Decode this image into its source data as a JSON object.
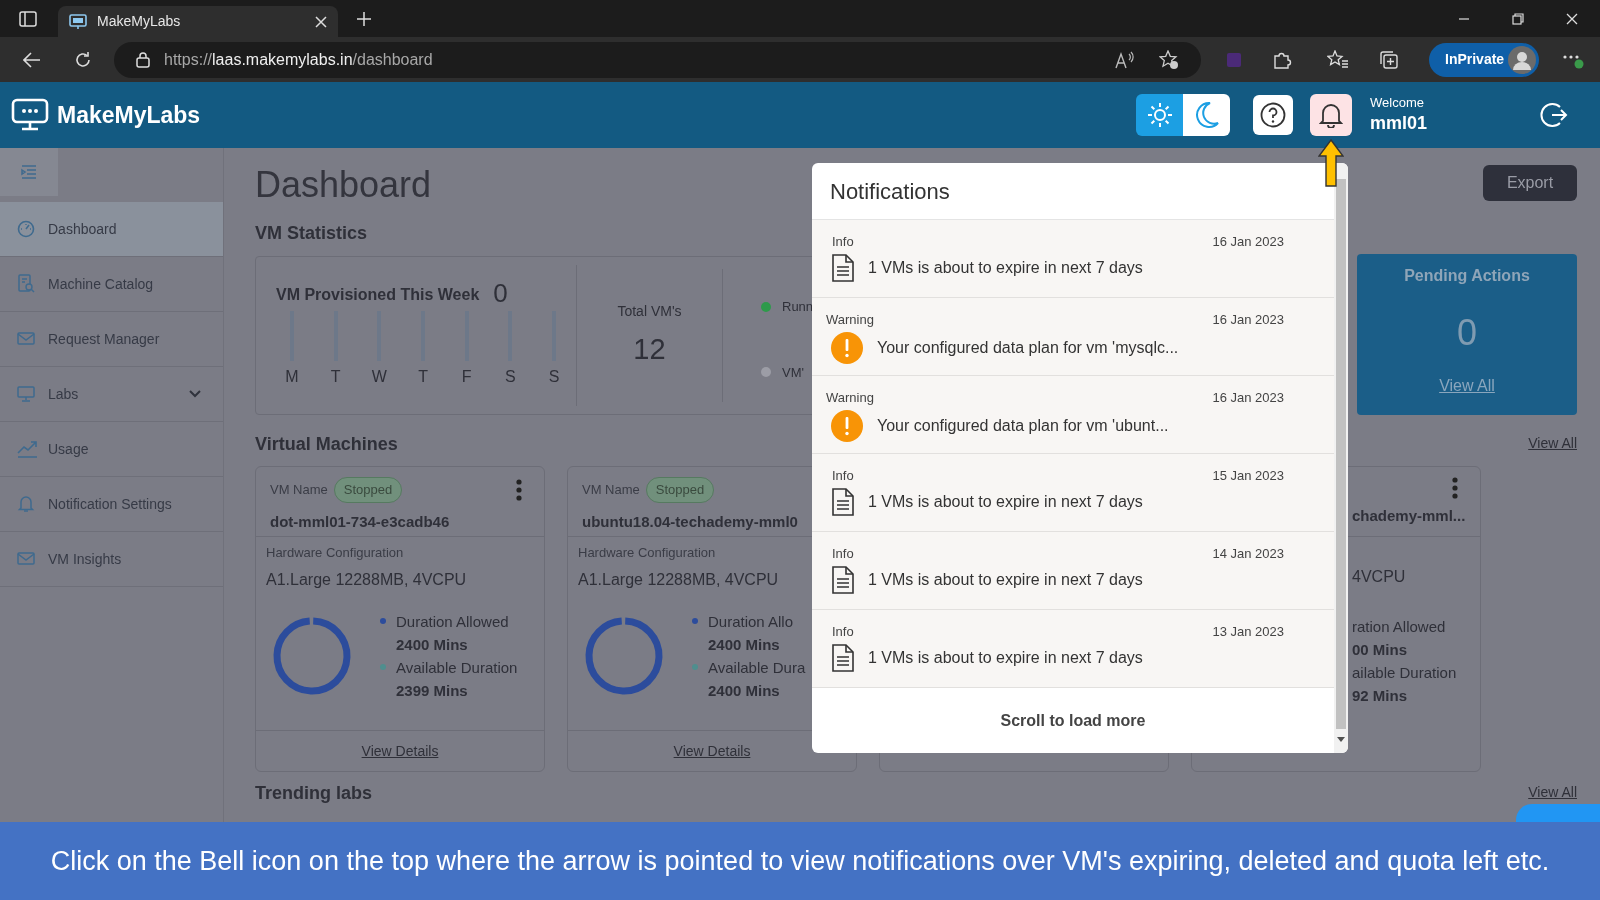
{
  "browser": {
    "tab_title": "MakeMyLabs",
    "url_scheme": "https://",
    "url_host": "laas.makemylabs.in",
    "url_path": "/dashboard",
    "profile_label": "InPrivate"
  },
  "header": {
    "brand": "MakeMyLabs",
    "theme_toggle": [
      {
        "kind": "light",
        "selected": true
      },
      {
        "kind": "dark",
        "selected": false
      }
    ],
    "welcome": "Welcome",
    "user": "mml01"
  },
  "sidebar": {
    "items": [
      {
        "kind": "gauge",
        "label": "Dashboard",
        "selected": true
      },
      {
        "kind": "catalog",
        "label": "Machine Catalog",
        "selected": false
      },
      {
        "kind": "mail",
        "label": "Request Manager",
        "selected": false
      },
      {
        "kind": "monitor",
        "label": "Labs",
        "selected": false,
        "expanded": false
      },
      {
        "kind": "chart",
        "label": "Usage",
        "selected": false
      },
      {
        "kind": "bell",
        "label": "Notification Settings",
        "selected": false
      },
      {
        "kind": "mail",
        "label": "VM Insights",
        "selected": false
      }
    ]
  },
  "page_title": "Dashboard",
  "export_button": "Export",
  "vm_statistics": {
    "heading": "VM Statistics",
    "provisioned_label": "VM Provisioned This Week",
    "provisioned_count": "0",
    "days": [
      {
        "label": "M"
      },
      {
        "label": "T"
      },
      {
        "label": "W"
      },
      {
        "label": "T"
      },
      {
        "label": "F"
      },
      {
        "label": "S"
      },
      {
        "label": "S"
      }
    ],
    "total_label": "Total VM's",
    "total": "12",
    "legend": [
      {
        "label": "Runn",
        "color": "#2e9a4b"
      },
      {
        "label": "VM'",
        "color": "#9c9da6"
      }
    ]
  },
  "pending_actions": {
    "title": "Pending Actions",
    "count": "0",
    "link": "View All"
  },
  "virtual_machines": {
    "heading": "Virtual Machines",
    "view_all": "View All",
    "cards": [
      {
        "name_label": "VM Name",
        "status": "Stopped",
        "name": "dot-mml01-734-e3cadb46",
        "hw_label": "Hardware Configuration",
        "hw": "A1.Large 12288MB, 4VCPU",
        "allowed_label": "Duration Allowed",
        "allowed": "2400 Mins",
        "available_label": "Available Duration",
        "available": "2399 Mins",
        "link": "View Details"
      },
      {
        "name_label": "VM Name",
        "status": "Stopped",
        "name": "ubuntu18.04-techademy-mml0",
        "hw_label": "Hardware Configuration",
        "hw": "A1.Large 12288MB, 4VCPU",
        "allowed_label": "Duration Allo",
        "allowed": "2400 Mins",
        "available_label": "Available Dura",
        "available": "2400 Mins",
        "link": "View Details"
      }
    ],
    "partial_card": {
      "name": "chademy-mml...",
      "hw": "4VCPU",
      "allowed_label": "ration Allowed",
      "allowed": "00 Mins",
      "available_label": "ailable Duration",
      "available": "92 Mins"
    }
  },
  "trending": {
    "heading": "Trending labs",
    "view_all": "View All"
  },
  "notifications": {
    "title": "Notifications",
    "items": [
      {
        "kind": "info",
        "type_label": "Info",
        "date": "16 Jan 2023",
        "message": "1 VMs is about to expire in next 7 days"
      },
      {
        "kind": "warning",
        "type_label": "Warning",
        "date": "16 Jan 2023",
        "message": "Your configured data plan for vm 'mysqlc..."
      },
      {
        "kind": "warning",
        "type_label": "Warning",
        "date": "16 Jan 2023",
        "message": "Your configured data plan for vm 'ubunt..."
      },
      {
        "kind": "info",
        "type_label": "Info",
        "date": "15 Jan 2023",
        "message": "1 VMs is about to expire in next 7 days"
      },
      {
        "kind": "info",
        "type_label": "Info",
        "date": "14 Jan 2023",
        "message": "1 VMs is about to expire in next 7 days"
      },
      {
        "kind": "info",
        "type_label": "Info",
        "date": "13 Jan 2023",
        "message": "1 VMs is about to expire in next 7 days"
      }
    ],
    "footer": "Scroll to load more"
  },
  "caption": "Click on the Bell icon on the top where the arrow is pointed to view notifications over VM's expiring, deleted and quota left etc."
}
